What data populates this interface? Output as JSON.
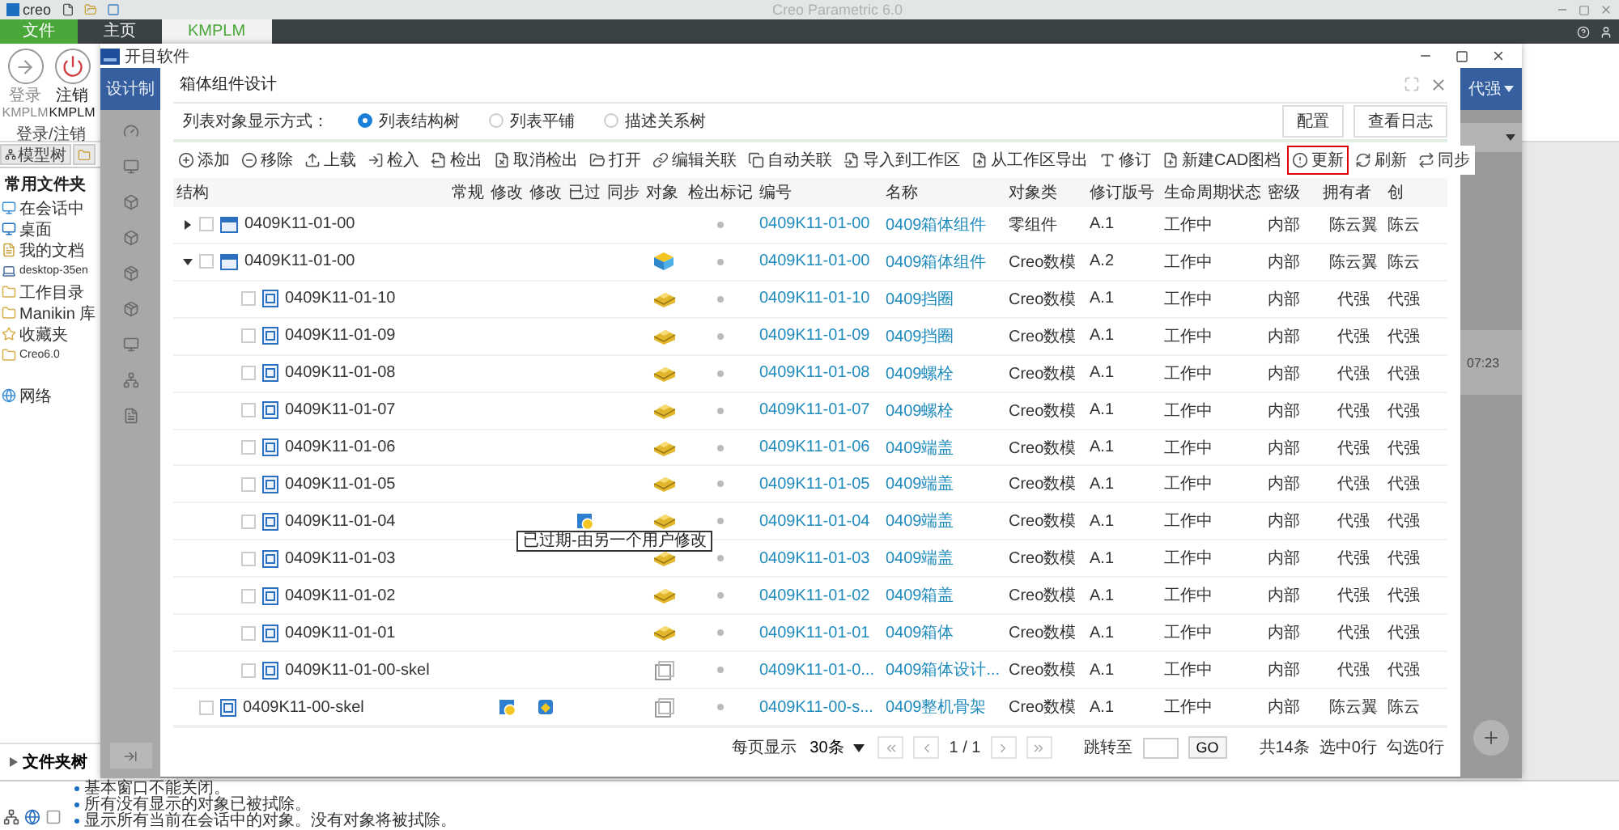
{
  "title_bar": {
    "logo": "creo",
    "title": "Creo Parametric 6.0"
  },
  "ribbon_tabs": [
    {
      "label": "文件",
      "kind": "file",
      "selected": false
    },
    {
      "label": "主页",
      "kind": "tab",
      "selected": false
    },
    {
      "label": "KMPLM",
      "kind": "tab",
      "selected": true
    }
  ],
  "ribbon": {
    "buttons": [
      {
        "label": "登录",
        "sub": "KMPLM",
        "disabled": true
      },
      {
        "label": "注销",
        "sub": "KMPLM",
        "disabled": false
      }
    ],
    "group": "登录/注销"
  },
  "navigator": {
    "tab": "模型树",
    "section": "常用文件夹",
    "folders": [
      "在会话中",
      "桌面",
      "我的文档",
      "desktop-35en",
      "工作目录",
      "Manikin 库",
      "收藏夹",
      "Creo6.0"
    ],
    "network": "网络",
    "folder_tree": "文件夹树"
  },
  "messages": [
    "基本窗口不能关闭。",
    "所有没有显示的对象已被拭除。",
    "显示所有当前在会话中的对象。没有对象将被拭除。"
  ],
  "web_window": {
    "brand": "开目软件",
    "left_banner": "设计制",
    "user": "代强",
    "time": "07:23"
  },
  "dialog": {
    "title": "箱体组件设计",
    "display_label": "列表对象显示方式：",
    "display_modes": [
      {
        "label": "列表结构树",
        "selected": true
      },
      {
        "label": "列表平铺",
        "selected": false
      },
      {
        "label": "描述关系树",
        "selected": false
      }
    ],
    "buttons": [
      "配置",
      "查看日志"
    ],
    "toolbar": [
      {
        "label": "添加",
        "selected": false
      },
      {
        "label": "移除",
        "selected": false
      },
      {
        "label": "上载",
        "selected": false
      },
      {
        "label": "检入",
        "selected": false
      },
      {
        "label": "检出",
        "selected": false
      },
      {
        "label": "取消检出",
        "selected": false
      },
      {
        "label": "打开",
        "selected": false
      },
      {
        "label": "编辑关联",
        "selected": false
      },
      {
        "label": "自动关联",
        "selected": false
      },
      {
        "label": "导入到工作区",
        "selected": false
      },
      {
        "label": "从工作区导出",
        "selected": false
      },
      {
        "label": "修订",
        "selected": false
      },
      {
        "label": "新建CAD图档",
        "selected": false
      },
      {
        "label": "更新",
        "selected": true
      },
      {
        "label": "刷新",
        "selected": false
      },
      {
        "label": "同步",
        "selected": false
      }
    ],
    "columns": [
      "结构",
      "常规",
      "修改",
      "修改",
      "已过",
      "同步",
      "对象",
      "检出标记",
      "编号",
      "名称",
      "对象类",
      "修订版号",
      "生命周期状态",
      "密级",
      "拥有者",
      "创"
    ],
    "rows": [
      {
        "structure": "0409K11-01-00",
        "expanded": false,
        "checked": false,
        "kind": "assembly",
        "has_model": false,
        "modified": false,
        "modified_local": false,
        "outdated": false,
        "number": "0409K11-01-00",
        "name": "0409箱体组件",
        "class": "零组件",
        "revision": "A.1",
        "state": "工作中",
        "secret": "内部",
        "owner": "陈云翼",
        "creator": "陈云"
      },
      {
        "structure": "0409K11-01-00",
        "expanded": true,
        "checked": false,
        "kind": "assembly",
        "has_model": true,
        "modified": false,
        "modified_local": false,
        "outdated": false,
        "number": "0409K11-01-00",
        "name": "0409箱体组件",
        "class": "Creo数模",
        "revision": "A.2",
        "state": "工作中",
        "secret": "内部",
        "owner": "陈云翼",
        "creator": "陈云",
        "children": [
          {
            "structure": "0409K11-01-10",
            "checked": false,
            "kind": "part",
            "has_model": true,
            "modified": false,
            "modified_local": false,
            "outdated": false,
            "number": "0409K11-01-10",
            "name": "0409挡圈",
            "class": "Creo数模",
            "revision": "A.1",
            "state": "工作中",
            "secret": "内部",
            "owner": "代强",
            "creator": "代强"
          },
          {
            "structure": "0409K11-01-09",
            "checked": false,
            "kind": "part",
            "has_model": true,
            "modified": false,
            "modified_local": false,
            "outdated": false,
            "number": "0409K11-01-09",
            "name": "0409挡圈",
            "class": "Creo数模",
            "revision": "A.1",
            "state": "工作中",
            "secret": "内部",
            "owner": "代强",
            "creator": "代强"
          },
          {
            "structure": "0409K11-01-08",
            "checked": false,
            "kind": "part",
            "has_model": true,
            "modified": false,
            "modified_local": false,
            "outdated": false,
            "number": "0409K11-01-08",
            "name": "0409螺栓",
            "class": "Creo数模",
            "revision": "A.1",
            "state": "工作中",
            "secret": "内部",
            "owner": "代强",
            "creator": "代强"
          },
          {
            "structure": "0409K11-01-07",
            "checked": false,
            "kind": "part",
            "has_model": true,
            "modified": false,
            "modified_local": false,
            "outdated": false,
            "number": "0409K11-01-07",
            "name": "0409螺栓",
            "class": "Creo数模",
            "revision": "A.1",
            "state": "工作中",
            "secret": "内部",
            "owner": "代强",
            "creator": "代强"
          },
          {
            "structure": "0409K11-01-06",
            "checked": false,
            "kind": "part",
            "has_model": true,
            "modified": false,
            "modified_local": false,
            "outdated": false,
            "number": "0409K11-01-06",
            "name": "0409端盖",
            "class": "Creo数模",
            "revision": "A.1",
            "state": "工作中",
            "secret": "内部",
            "owner": "代强",
            "creator": "代强"
          },
          {
            "structure": "0409K11-01-05",
            "checked": false,
            "kind": "part",
            "has_model": true,
            "modified": false,
            "modified_local": false,
            "outdated": false,
            "number": "0409K11-01-05",
            "name": "0409端盖",
            "class": "Creo数模",
            "revision": "A.1",
            "state": "工作中",
            "secret": "内部",
            "owner": "代强",
            "creator": "代强"
          },
          {
            "structure": "0409K11-01-04",
            "checked": false,
            "kind": "part",
            "has_model": true,
            "modified": false,
            "modified_local": false,
            "outdated": true,
            "tooltip": "已过期-由另一个用户修改",
            "number": "0409K11-01-04",
            "name": "0409端盖",
            "class": "Creo数模",
            "revision": "A.1",
            "state": "工作中",
            "secret": "内部",
            "owner": "代强",
            "creator": "代强"
          },
          {
            "structure": "0409K11-01-03",
            "checked": false,
            "kind": "part",
            "has_model": true,
            "modified": false,
            "modified_local": false,
            "outdated": false,
            "number": "0409K11-01-03",
            "name": "0409端盖",
            "class": "Creo数模",
            "revision": "A.1",
            "state": "工作中",
            "secret": "内部",
            "owner": "代强",
            "creator": "代强"
          },
          {
            "structure": "0409K11-01-02",
            "checked": false,
            "kind": "part",
            "has_model": true,
            "modified": false,
            "modified_local": false,
            "outdated": false,
            "number": "0409K11-01-02",
            "name": "0409箱盖",
            "class": "Creo数模",
            "revision": "A.1",
            "state": "工作中",
            "secret": "内部",
            "owner": "代强",
            "creator": "代强"
          },
          {
            "structure": "0409K11-01-01",
            "checked": false,
            "kind": "part",
            "has_model": true,
            "modified": false,
            "modified_local": false,
            "outdated": false,
            "number": "0409K11-01-01",
            "name": "0409箱体",
            "class": "Creo数模",
            "revision": "A.1",
            "state": "工作中",
            "secret": "内部",
            "owner": "代强",
            "creator": "代强"
          },
          {
            "structure": "0409K11-01-00-skel",
            "checked": false,
            "kind": "skeleton",
            "has_model": true,
            "modified": false,
            "modified_local": false,
            "outdated": false,
            "number": "0409K11-01-0...",
            "name": "0409箱体设计...",
            "class": "Creo数模",
            "revision": "A.1",
            "state": "工作中",
            "secret": "内部",
            "owner": "代强",
            "creator": "代强"
          }
        ]
      },
      {
        "structure": "0409K11-00-skel",
        "checked": false,
        "kind": "skeleton",
        "has_model": true,
        "modified": true,
        "modified_local": true,
        "outdated": false,
        "number": "0409K11-00-s...",
        "name": "0409整机骨架",
        "class": "Creo数模",
        "revision": "A.1",
        "state": "工作中",
        "secret": "内部",
        "owner": "陈云翼",
        "creator": "陈云"
      }
    ],
    "pager": {
      "per_page_label": "每页显示",
      "page_size": "30条",
      "page": "1 / 1",
      "jump_label": "跳转至",
      "go": "GO",
      "total": "共14条",
      "selected": "选中0行",
      "checked": "勾选0行"
    }
  }
}
